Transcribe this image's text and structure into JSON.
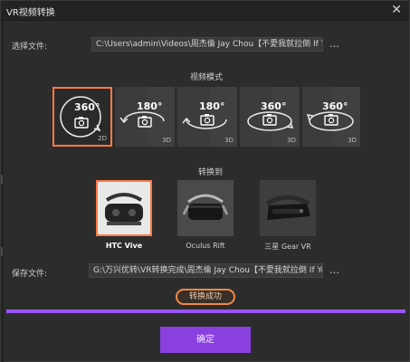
{
  "window": {
    "title": "VR视频转换"
  },
  "source": {
    "label": "选择文件:",
    "path": "C:\\Users\\admin\\Videos\\周杰倫 Jay Chou【不愛我就拉倒 If You D"
  },
  "mode_section": {
    "title": "视频模式",
    "modes": [
      {
        "degrees": "360°",
        "tag": "2D",
        "icon": "camera-rotate-icon",
        "selected": true
      },
      {
        "degrees": "180°",
        "tag": "3D",
        "icon": "camera-rotate-icon",
        "selected": false
      },
      {
        "degrees": "180°",
        "tag": "3D",
        "icon": "camera-rotate-icon",
        "selected": false
      },
      {
        "degrees": "360°",
        "tag": "3D",
        "icon": "camera-rotate-icon",
        "selected": false
      },
      {
        "degrees": "360°",
        "tag": "3D",
        "icon": "camera-rotate-icon",
        "selected": false
      }
    ]
  },
  "convert_section": {
    "title": "转换到",
    "devices": [
      {
        "label": "HTC Vive",
        "icon": "vr-headset-icon",
        "selected": true
      },
      {
        "label": "Oculus Rift",
        "icon": "vr-headset-icon",
        "selected": false
      },
      {
        "label": "三星 Gear VR",
        "icon": "vr-headset-icon",
        "selected": false
      }
    ]
  },
  "output": {
    "label": "保存文件:",
    "path": "G:\\万兴优转\\VR转换完成\\周杰倫 Jay Chou【不愛我就拉倒 If You"
  },
  "status": {
    "success_label": "转换成功",
    "progress_fraction": 1.0
  },
  "actions": {
    "confirm_label": "确定"
  },
  "colors": {
    "accent": "#8a40df",
    "selected_border": "#ff7a45",
    "progress": "#9a55ff"
  },
  "icons": {
    "more": "ellipsis-icon",
    "close": "close-icon"
  }
}
